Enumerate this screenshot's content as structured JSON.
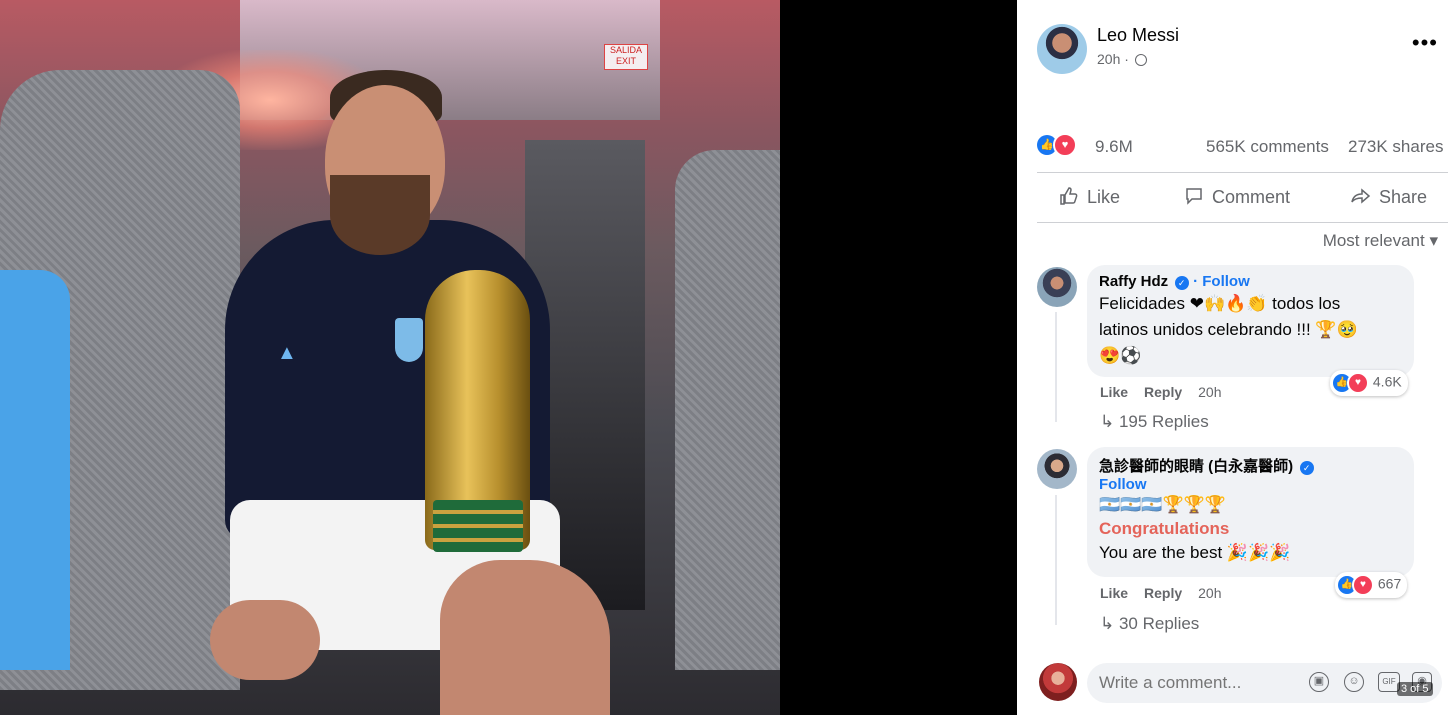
{
  "post": {
    "author": "Leo Messi",
    "time": "20h ·",
    "more": "•••",
    "reaction_count": "9.6M",
    "comments_count": "565K comments",
    "shares_count": "273K shares"
  },
  "actions": {
    "like": "Like",
    "comment": "Comment",
    "share": "Share"
  },
  "sort_label": "Most relevant ▾",
  "comments": [
    {
      "name": "Raffy Hdz",
      "follow": "Follow",
      "line1": "Felicidades ❤🙌🔥👏 todos los",
      "line2": "latinos unidos celebrando !!! 🏆🥹",
      "line3": "😍⚽",
      "reactions": "4.6K",
      "like": "Like",
      "reply": "Reply",
      "time": "20h",
      "replies": "↳ 195 Replies"
    },
    {
      "name": "急診醫師的眼睛 (白永嘉醫師)",
      "follow": "Follow",
      "line1": "🇦🇷🇦🇷🇦🇷🏆🏆🏆",
      "line2": "Congratulations",
      "line3": "You are the best 🎉🎉🎉",
      "reactions": "667",
      "like": "Like",
      "reply": "Reply",
      "time": "20h",
      "replies": "↳ 30 Replies"
    }
  ],
  "composer": {
    "placeholder": "Write a comment..."
  },
  "photo": {
    "exit_sign": "SALIDA EXIT",
    "page_counter": "3 of 5"
  },
  "icons": {
    "globe": "globe-icon",
    "like": "thumbs-up-icon",
    "comment": "speech-bubble-icon",
    "share": "share-arrow-icon"
  },
  "colors": {
    "brand": "#1877f2",
    "love": "#f33e58",
    "muted": "#65676b"
  }
}
